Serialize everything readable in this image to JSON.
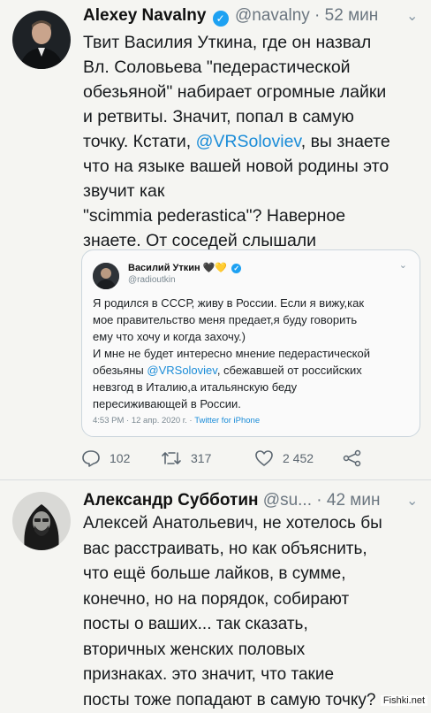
{
  "tweet1": {
    "author": "Alexey Navalny",
    "handle": "@navalny",
    "separator": "·",
    "time": "52 мин",
    "text_lines": [
      "Твит Василия Уткина, где он назвал",
      "Вл. Соловьева \"педерастической",
      "обезьяной\" набирает огромные лайки",
      "и ретвиты. Значит, попал в самую",
      "точку. Кстати, ",
      "@VRSoloviev",
      ", вы знаете",
      "что на языке вашей новой родины это",
      "звучит как",
      "\"scimmia pederastica\"? Наверное",
      "знаете. От соседей слышали"
    ],
    "quote": {
      "author": "Василий Уткин",
      "emoji": "🖤💛",
      "handle": "@radioutkin",
      "p1_lines": [
        "Я родился в СССР, живу в России. Если я вижу,как",
        "мое правительство меня предает,я буду говорить",
        "ему что хочу и когда захочу.)"
      ],
      "p2_line1": "И мне не будет интересно мнение педерастической",
      "p2_prefix": "обезьяны ",
      "p2_mention": "@VRSoloviev",
      "p2_suffix": ", сбежавшей от российских",
      "p2_lines_rest": [
        "невзгод в Италию,а итальянскую беду",
        "пересиживающей в России."
      ],
      "meta": "4:53 PM · 12 апр. 2020 г. · ",
      "source": "Twitter for iPhone"
    },
    "actions": {
      "replies": "102",
      "retweets": "317",
      "likes": "2 452"
    }
  },
  "tweet2": {
    "author": "Александр Субботин",
    "handle": "@su...",
    "separator": "·",
    "time": "42 мин",
    "text_lines": [
      "Алексей Анатольевич, не хотелось бы",
      "вас расстраивать, но как объяснить,",
      "что ещё больше лайков, в сумме,",
      "конечно, но на порядок, собирают",
      "посты о ваших... так сказать,",
      "вторичных женских половых",
      "признаках. это значит, что такие",
      "посты тоже попадают в самую точку?"
    ]
  },
  "watermark": "Fishki.net",
  "colors": {
    "link": "#1a8cd8",
    "verified": "#1da1f2",
    "muted": "#6b7680",
    "background": "#f5f5f2"
  }
}
